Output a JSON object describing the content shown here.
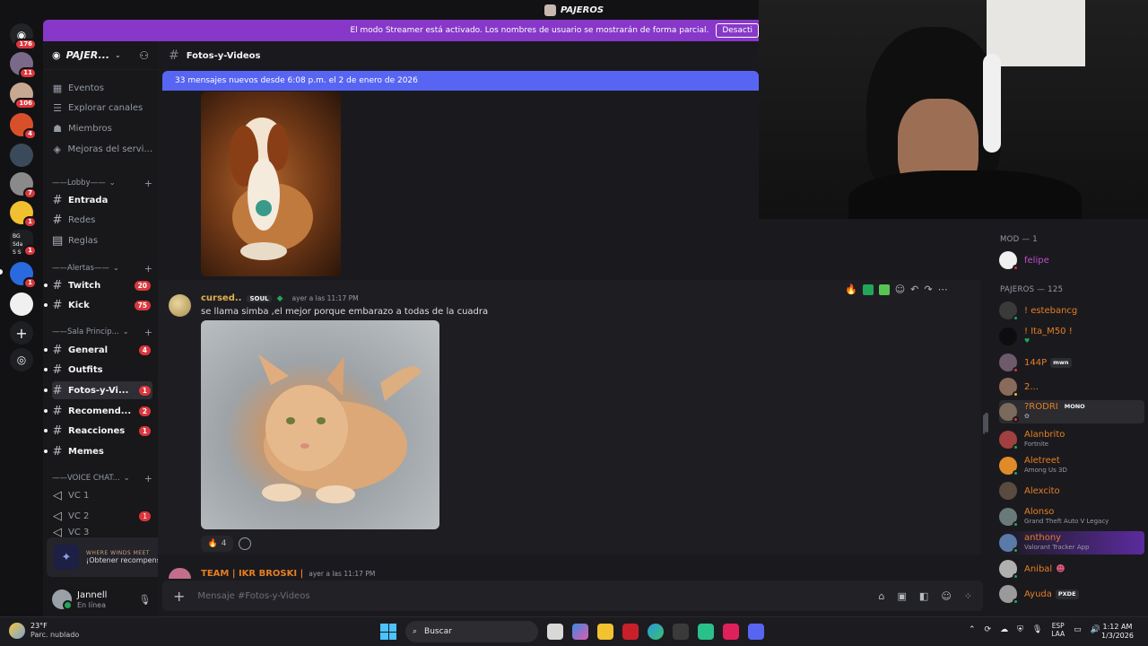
{
  "window": {
    "title": "PAJEROS"
  },
  "banner": {
    "message": "El modo Streamer está activado. Los nombres de usuario se mostrarán de forma parcial.",
    "button": "Desacti"
  },
  "rail": {
    "badges": [
      "176",
      "11",
      "106",
      "4",
      "7",
      "1",
      "1",
      "1"
    ],
    "small_labels": [
      "BG",
      "Sda",
      "S",
      "S"
    ]
  },
  "guild": {
    "name": "PAJER..."
  },
  "sidebar": {
    "nav": [
      {
        "label": "Eventos",
        "icon": "calendar-icon"
      },
      {
        "label": "Explorar canales",
        "icon": "browse-icon"
      },
      {
        "label": "Miembros",
        "icon": "members-icon"
      },
      {
        "label": "Mejoras del servi...",
        "icon": "boost-icon"
      }
    ],
    "categories": [
      {
        "name": "——Lobby——",
        "channels": [
          {
            "label": "Entrada",
            "icon": "hash",
            "count": ""
          },
          {
            "label": "Redes",
            "icon": "hash",
            "count": "",
            "dim": true
          },
          {
            "label": "Reglas",
            "icon": "rules",
            "count": "",
            "dim": true
          }
        ]
      },
      {
        "name": "——Alertas——",
        "channels": [
          {
            "label": "Twitch",
            "icon": "hash",
            "count": "20"
          },
          {
            "label": "Kick",
            "icon": "hash",
            "count": "75"
          }
        ]
      },
      {
        "name": "——Sala Princip...",
        "channels": [
          {
            "label": "General",
            "icon": "hash",
            "count": "4"
          },
          {
            "label": "Outfits",
            "icon": "hash",
            "count": ""
          },
          {
            "label": "Fotos-y-Vi...",
            "icon": "hash",
            "count": "1"
          },
          {
            "label": "Recomend...",
            "icon": "hash",
            "count": "2"
          },
          {
            "label": "Reacciones",
            "icon": "hash",
            "count": "1"
          },
          {
            "label": "Memes",
            "icon": "hash",
            "count": ""
          }
        ]
      },
      {
        "name": "——VOICE CHAT...",
        "channels": [
          {
            "label": "VC 1",
            "icon": "speaker",
            "count": ""
          },
          {
            "label": "VC 2",
            "icon": "speaker",
            "count": "1"
          },
          {
            "label": "VC 3",
            "icon": "speaker",
            "count": ""
          }
        ]
      }
    ]
  },
  "quest": {
    "title": "WHERE WINDS MEET",
    "action": "¡Obtener recompensa!"
  },
  "user": {
    "name": "Jannell",
    "status": "En línea"
  },
  "channel": {
    "name": "Fotos-y-Videos"
  },
  "new_messages": "33 mensajes nuevos desde 6:08 p.m. el 2 de enero de 2026",
  "message": {
    "author": "cursed..",
    "tag": "SOUL",
    "time": "ayer a las 11:17 PM",
    "text": "se llama simba ,el mejor porque embarazo a todas de la cuadra",
    "reaction_count": "4"
  },
  "next_message": {
    "author": "TEAM | IKR BROSKI |",
    "time": "ayer a las 11:17 PM"
  },
  "composer": {
    "placeholder": "Mensaje #Fotos-y-Videos"
  },
  "members": {
    "groups": [
      {
        "label": "MOD — 1"
      },
      {
        "label": "PAJEROS — 125"
      }
    ],
    "list": [
      {
        "name": "felipe",
        "activity": "",
        "tag": "",
        "color": "#c04cd0",
        "avatar": "#f0f0f0"
      },
      {
        "name": "! estebancg",
        "activity": "",
        "tag": "",
        "color": "#e67e22",
        "avatar": "#3a3a3a"
      },
      {
        "name": "! Ita_M50 !",
        "activity": "",
        "tag": "",
        "color": "#e67e22",
        "avatar": "#0d0d0d"
      },
      {
        "name": "144P",
        "activity": "",
        "tag": "mwn",
        "color": "#e67e22",
        "avatar": "#6d5a6a"
      },
      {
        "name": "2...",
        "activity": "",
        "tag": "",
        "color": "#e67e22",
        "avatar": "#8a6a5a"
      },
      {
        "name": "?RODRI",
        "activity": "",
        "tag": "MONO",
        "color": "#e67e22",
        "avatar": "#7a6a5a"
      },
      {
        "name": "Alanbrito",
        "activity": "Fortnite",
        "tag": "",
        "color": "#e67e22",
        "avatar": "#a04040"
      },
      {
        "name": "Aletreet",
        "activity": "Among Us 3D",
        "tag": "",
        "color": "#e67e22",
        "avatar": "#e08a2a"
      },
      {
        "name": "Alexcito",
        "activity": "",
        "tag": "",
        "color": "#e67e22",
        "avatar": "#5a4a40"
      },
      {
        "name": "Alonso",
        "activity": "Grand Theft Auto V Legacy",
        "tag": "",
        "color": "#e67e22",
        "avatar": "#6a7a7a"
      },
      {
        "name": "anthony",
        "activity": "Valorant Tracker App",
        "tag": "",
        "color": "#e67e22",
        "avatar": "#5a7aaa"
      },
      {
        "name": "Anibal",
        "activity": "",
        "tag": "",
        "color": "#e67e22",
        "avatar": "#b0b0b0"
      },
      {
        "name": "Ayuda",
        "activity": "",
        "tag": "PXDE",
        "color": "#e67e22",
        "avatar": "#9a9a9a"
      }
    ]
  },
  "taskbar": {
    "temp": "23°F",
    "weather": "Parc. nublado",
    "search": "Buscar",
    "lang1": "ESP",
    "lang2": "LAA",
    "time": "1:12 AM",
    "date": "1/3/2026"
  }
}
